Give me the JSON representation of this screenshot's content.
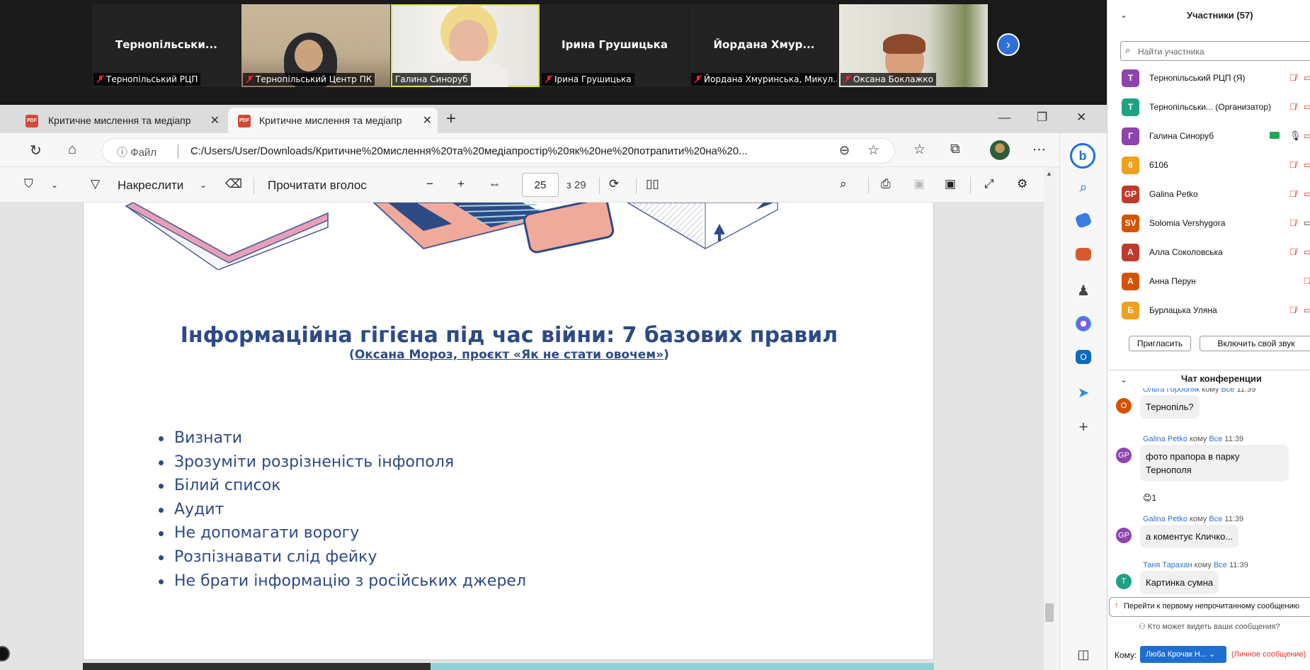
{
  "video_tiles": [
    {
      "display_name": "Тернопільськи...",
      "label": "Тернопільський РЦП",
      "type": "name"
    },
    {
      "display_name": "",
      "label": "Тернопільський Центр ПК",
      "type": "photo"
    },
    {
      "display_name": "",
      "label": "Галина Синоруб",
      "type": "photo",
      "active": true
    },
    {
      "display_name": "Ірина Грушицька",
      "label": "Ірина Грушицька",
      "type": "name"
    },
    {
      "display_name": "Йордана  Хмур...",
      "label": "Йордана Хмуринська, Микул...",
      "type": "name"
    },
    {
      "display_name": "",
      "label": "Оксана Боклажко",
      "type": "photo"
    }
  ],
  "browser": {
    "tabs": [
      {
        "label": "Критичне мислення та медіапр"
      },
      {
        "label": "Критичне мислення та медіапр"
      }
    ],
    "address": {
      "info": "Файл",
      "url": "C:/Users/User/Downloads/Критичне%20мислення%20та%20медіапростір%20як%20не%20потрапити%20на%20..."
    }
  },
  "pdf_toolbar": {
    "draw_label": "Накреслити",
    "read_aloud_label": "Прочитати вголос",
    "page_current": "25",
    "page_total": "з 29"
  },
  "slide": {
    "title": "Інформаційна гігієна під час війни: 7 базових правил",
    "subtitle_open": "(",
    "subtitle_link": "Оксана Мороз, проєкт «Як не стати овочем»",
    "subtitle_close": ")",
    "rules": [
      "Визнати",
      "Зрозуміти розрізненість інфополя",
      "Білий список",
      "Аудит",
      "Не допомагати ворогу",
      "Розпізнавати слід фейку",
      "Не брати інформацію з російських джерел"
    ]
  },
  "participants": {
    "title": "Участники (57)",
    "search_placeholder": "Найти участника",
    "list": [
      {
        "initials": "Т",
        "name": "Тернопільський РЦП (Я)",
        "color": "#8e44ad"
      },
      {
        "initials": "Т",
        "name": "Тернопільськи...  (Организатор)",
        "color": "#1fa184"
      },
      {
        "initials": "Г",
        "name": "Галина Синоруб",
        "color": "#8e44ad"
      },
      {
        "initials": "6",
        "name": "6106",
        "color": "#f0a11c"
      },
      {
        "initials": "GP",
        "name": "Galina Petko",
        "color": "#c0392b"
      },
      {
        "initials": "SV",
        "name": "Solomia Vershygora",
        "color": "#d35400"
      },
      {
        "initials": "А",
        "name": "Алла Соколовська",
        "color": "#c0392b"
      },
      {
        "initials": "А",
        "name": "Анна Перун",
        "color": "#d35400"
      },
      {
        "initials": "Б",
        "name": "Бурлацька Уляна",
        "color": "#f0a11c"
      }
    ],
    "invite_label": "Пригласить",
    "unmute_label": "Включить свой звук"
  },
  "chat": {
    "title": "Чат конференции",
    "to_word": "кому",
    "messages": [
      {
        "sender": "Ольга Горобляк",
        "to": "Все",
        "time": "11:39",
        "initials": "О",
        "color": "#d35400",
        "text": "Тернопіль?"
      },
      {
        "sender": "Galina Petko",
        "to": "Все",
        "time": "11:39",
        "initials": "GP",
        "color": "#8e44ad",
        "text": "фото прапора в парку Тернополя",
        "reaction": "😊1"
      },
      {
        "sender": "Galina Petko",
        "to": "Все",
        "time": "11:39",
        "initials": "GP",
        "color": "#8e44ad",
        "text": "а коментує Кличко..."
      },
      {
        "sender": "Таня Тарахан",
        "to": "Все",
        "time": "11:39",
        "initials": "Т",
        "color": "#1fa184",
        "text": "Картинка сумна"
      }
    ],
    "unread_label": "Перейти к первому непрочитанному сообщению",
    "who_sees": "Кто может видеть ваши сообщения?",
    "to_label": "Кому:",
    "recipient": "Люба Крочак Н...",
    "private_label": "(Личное сообщение)"
  }
}
